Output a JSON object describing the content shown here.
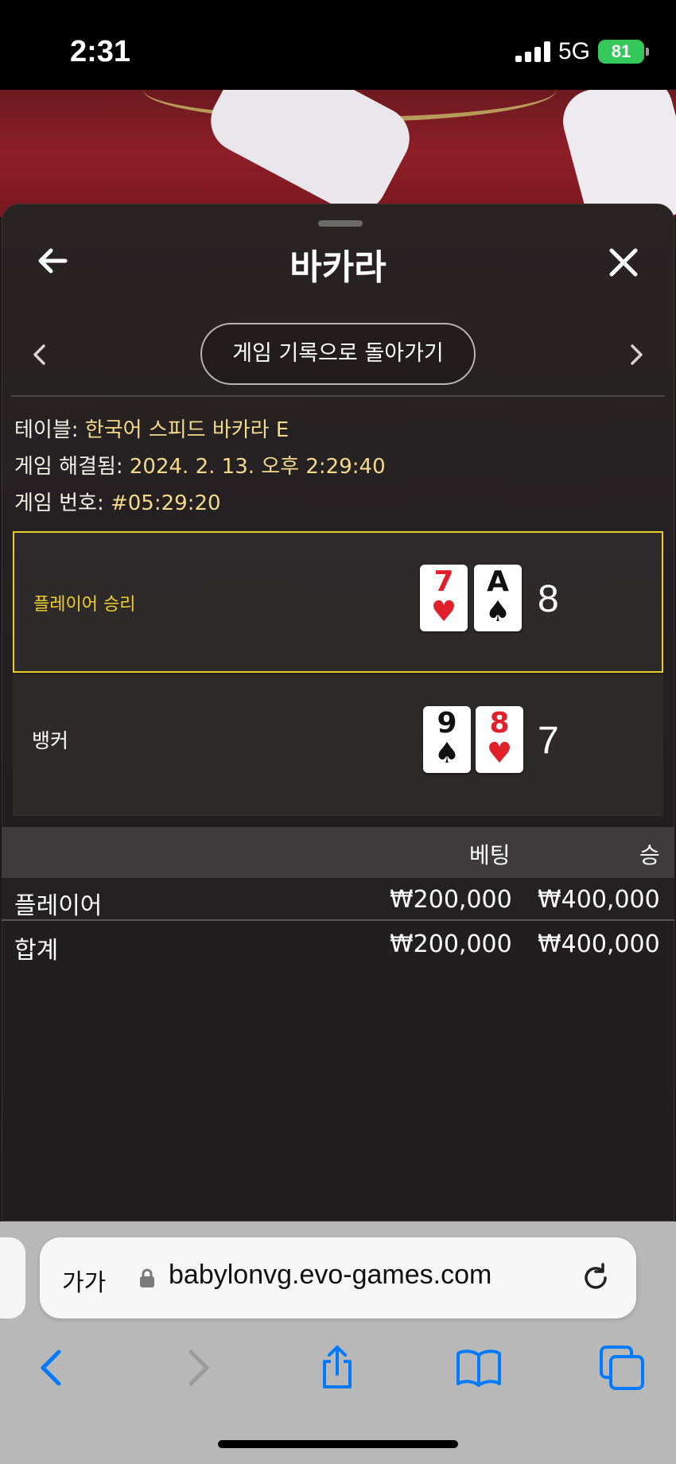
{
  "status": {
    "time": "2:31",
    "network": "5G",
    "battery": "81"
  },
  "header": {
    "title": "바카라",
    "history_button": "게임 기록으로 돌아가기"
  },
  "info": {
    "table_label": "테이블:",
    "table_value": "한국어 스피드 바카라 E",
    "resolved_label": "게임 해결됨:",
    "resolved_value": "2024. 2. 13. 오후 2:29:40",
    "number_label": "게임 번호:",
    "number_value": "#05:29:20"
  },
  "player": {
    "label": "플레이어 승리",
    "cards": [
      {
        "rank": "7",
        "suit": "♥"
      },
      {
        "rank": "A",
        "suit": "♠"
      }
    ],
    "score": "8"
  },
  "banker": {
    "label": "뱅커",
    "cards": [
      {
        "rank": "9",
        "suit": "♠"
      },
      {
        "rank": "8",
        "suit": "♥"
      }
    ],
    "score": "7"
  },
  "bets": {
    "col_bet": "베팅",
    "col_win": "승",
    "rows": [
      {
        "name": "플레이어",
        "bet": "₩200,000",
        "win": "₩400,000"
      },
      {
        "name": "합계",
        "bet": "₩200,000",
        "win": "₩400,000"
      }
    ]
  },
  "browser": {
    "aa": "가가",
    "url": "babylonvg.evo-games.com"
  },
  "colors": {
    "accent": "#f3d98a",
    "winner_border": "#e8cf28",
    "ios_blue": "#007aff"
  }
}
